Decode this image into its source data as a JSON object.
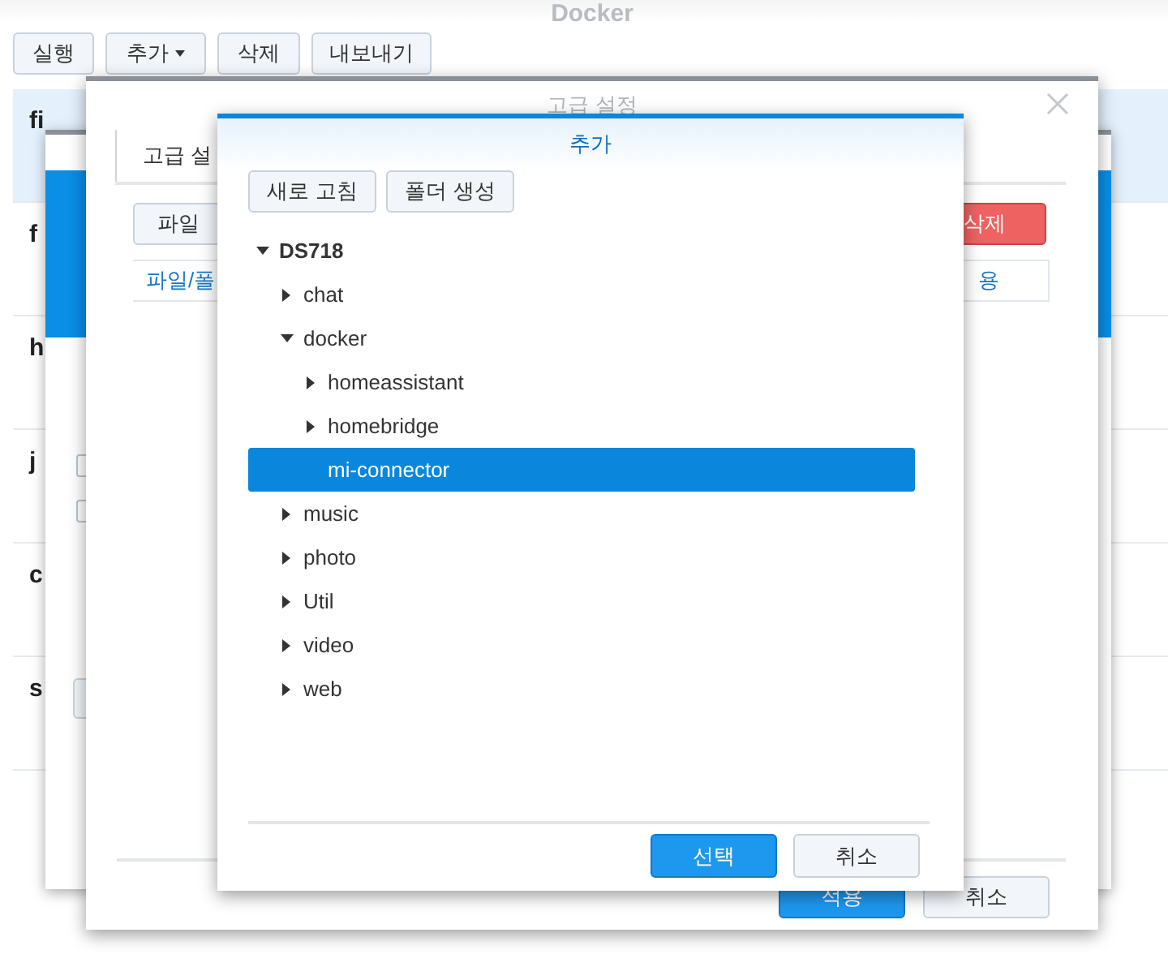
{
  "app": {
    "title": "Docker",
    "toolbar": [
      {
        "label": "실행",
        "dropdown": false
      },
      {
        "label": "추가",
        "dropdown": true
      },
      {
        "label": "삭제",
        "dropdown": false
      },
      {
        "label": "내보내기",
        "dropdown": false
      }
    ],
    "list": [
      {
        "name": "fi",
        "selected": true
      },
      {
        "name": "f",
        "selected": false
      },
      {
        "name": "h",
        "selected": false
      },
      {
        "name": "j",
        "selected": false
      },
      {
        "name": "c",
        "selected": false
      },
      {
        "name": "s",
        "selected": false
      }
    ]
  },
  "container_dialog": {
    "checkboxes": [
      {
        "checked": false
      },
      {
        "checked": false
      }
    ]
  },
  "advanced_settings": {
    "title": "고급 설정",
    "tabs": [
      {
        "label": "고급 설",
        "selected": true
      }
    ],
    "toolbar": [
      "파일"
    ],
    "delete_button": "삭제",
    "columns": [
      "파일/폴",
      "용"
    ],
    "buttons": [
      {
        "label": "적용",
        "kind": "primary"
      },
      {
        "label": "취소",
        "kind": "default"
      }
    ]
  },
  "add_dialog": {
    "title": "추가",
    "toolbar": [
      "새로 고침",
      "폴더 생성"
    ],
    "tree": [
      {
        "label": "DS718",
        "kind": "folder",
        "expanded": true,
        "selected": false,
        "children": [
          {
            "label": "chat",
            "kind": "folder",
            "expanded": false,
            "selected": false
          },
          {
            "label": "docker",
            "kind": "folder",
            "expanded": true,
            "selected": false,
            "children": [
              {
                "label": "homeassistant",
                "kind": "folder",
                "expanded": false,
                "selected": false
              },
              {
                "label": "homebridge",
                "kind": "folder",
                "expanded": false,
                "selected": false
              },
              {
                "label": "mi-connector",
                "kind": "leaf",
                "selected": true
              }
            ]
          },
          {
            "label": "music",
            "kind": "folder",
            "expanded": false,
            "selected": false
          },
          {
            "label": "photo",
            "kind": "folder",
            "expanded": false,
            "selected": false
          },
          {
            "label": "Util",
            "kind": "folder",
            "expanded": false,
            "selected": false
          },
          {
            "label": "video",
            "kind": "folder",
            "expanded": false,
            "selected": false
          },
          {
            "label": "web",
            "kind": "folder",
            "expanded": false,
            "selected": false
          }
        ]
      }
    ],
    "buttons": [
      {
        "label": "선택",
        "kind": "primary"
      },
      {
        "label": "취소",
        "kind": "default"
      }
    ]
  }
}
